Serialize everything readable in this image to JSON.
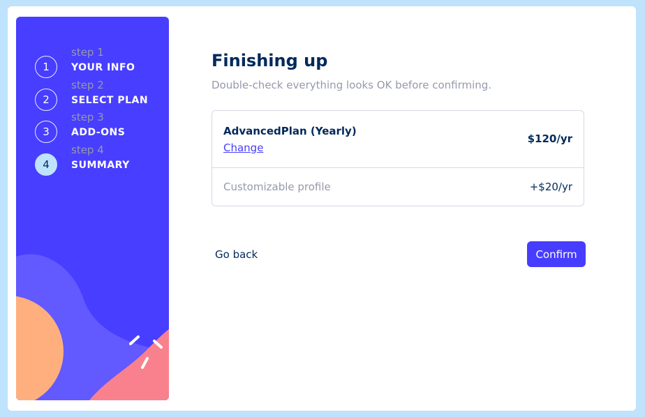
{
  "steps": [
    {
      "number": "1",
      "label": "step 1",
      "title": "YOUR INFO",
      "active": false
    },
    {
      "number": "2",
      "label": "step 2",
      "title": "SELECT PLAN",
      "active": false
    },
    {
      "number": "3",
      "label": "step 3",
      "title": "ADD-ONS",
      "active": false
    },
    {
      "number": "4",
      "label": "step 4",
      "title": "SUMMARY",
      "active": true
    }
  ],
  "main": {
    "title": "Finishing up",
    "subtitle": "Double-check everything looks OK before confirming."
  },
  "summary": {
    "plan_name": "AdvancedPlan (Yearly)",
    "change_label": "Change",
    "plan_price": "$120/yr",
    "addons": [
      {
        "name": "Customizable profile",
        "price": "+$20/yr"
      }
    ]
  },
  "actions": {
    "back_label": "Go back",
    "confirm_label": "Confirm"
  },
  "colors": {
    "page_background": "#bfe2fd",
    "sidebar": "#483eff",
    "accent": "#473dff",
    "marine_blue": "#02295a",
    "cool_gray": "#9699ab",
    "orange_blob": "#ffaf7e",
    "pink_blob": "#f9818e"
  }
}
